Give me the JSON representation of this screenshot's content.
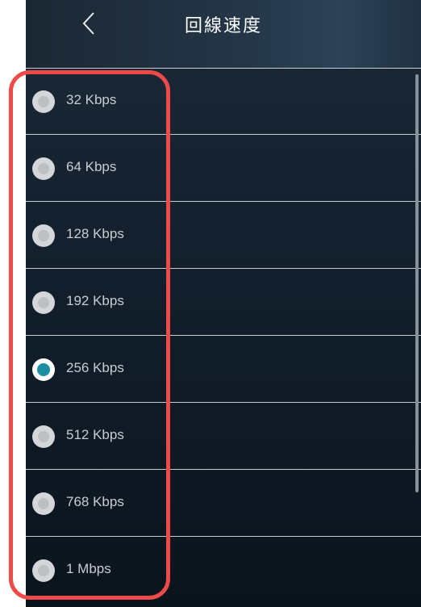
{
  "header": {
    "title": "回線速度",
    "back_icon": "chevron-left-icon"
  },
  "speed_options": [
    {
      "label": "32 Kbps",
      "selected": false
    },
    {
      "label": "64 Kbps",
      "selected": false
    },
    {
      "label": "128 Kbps",
      "selected": false
    },
    {
      "label": "192 Kbps",
      "selected": false
    },
    {
      "label": "256 Kbps",
      "selected": true
    },
    {
      "label": "512 Kbps",
      "selected": false
    },
    {
      "label": "768 Kbps",
      "selected": false
    },
    {
      "label": "1 Mbps",
      "selected": false
    }
  ],
  "colors": {
    "selected_radio": "#1b8ea6",
    "highlight_annotation": "#ee4a4a"
  }
}
